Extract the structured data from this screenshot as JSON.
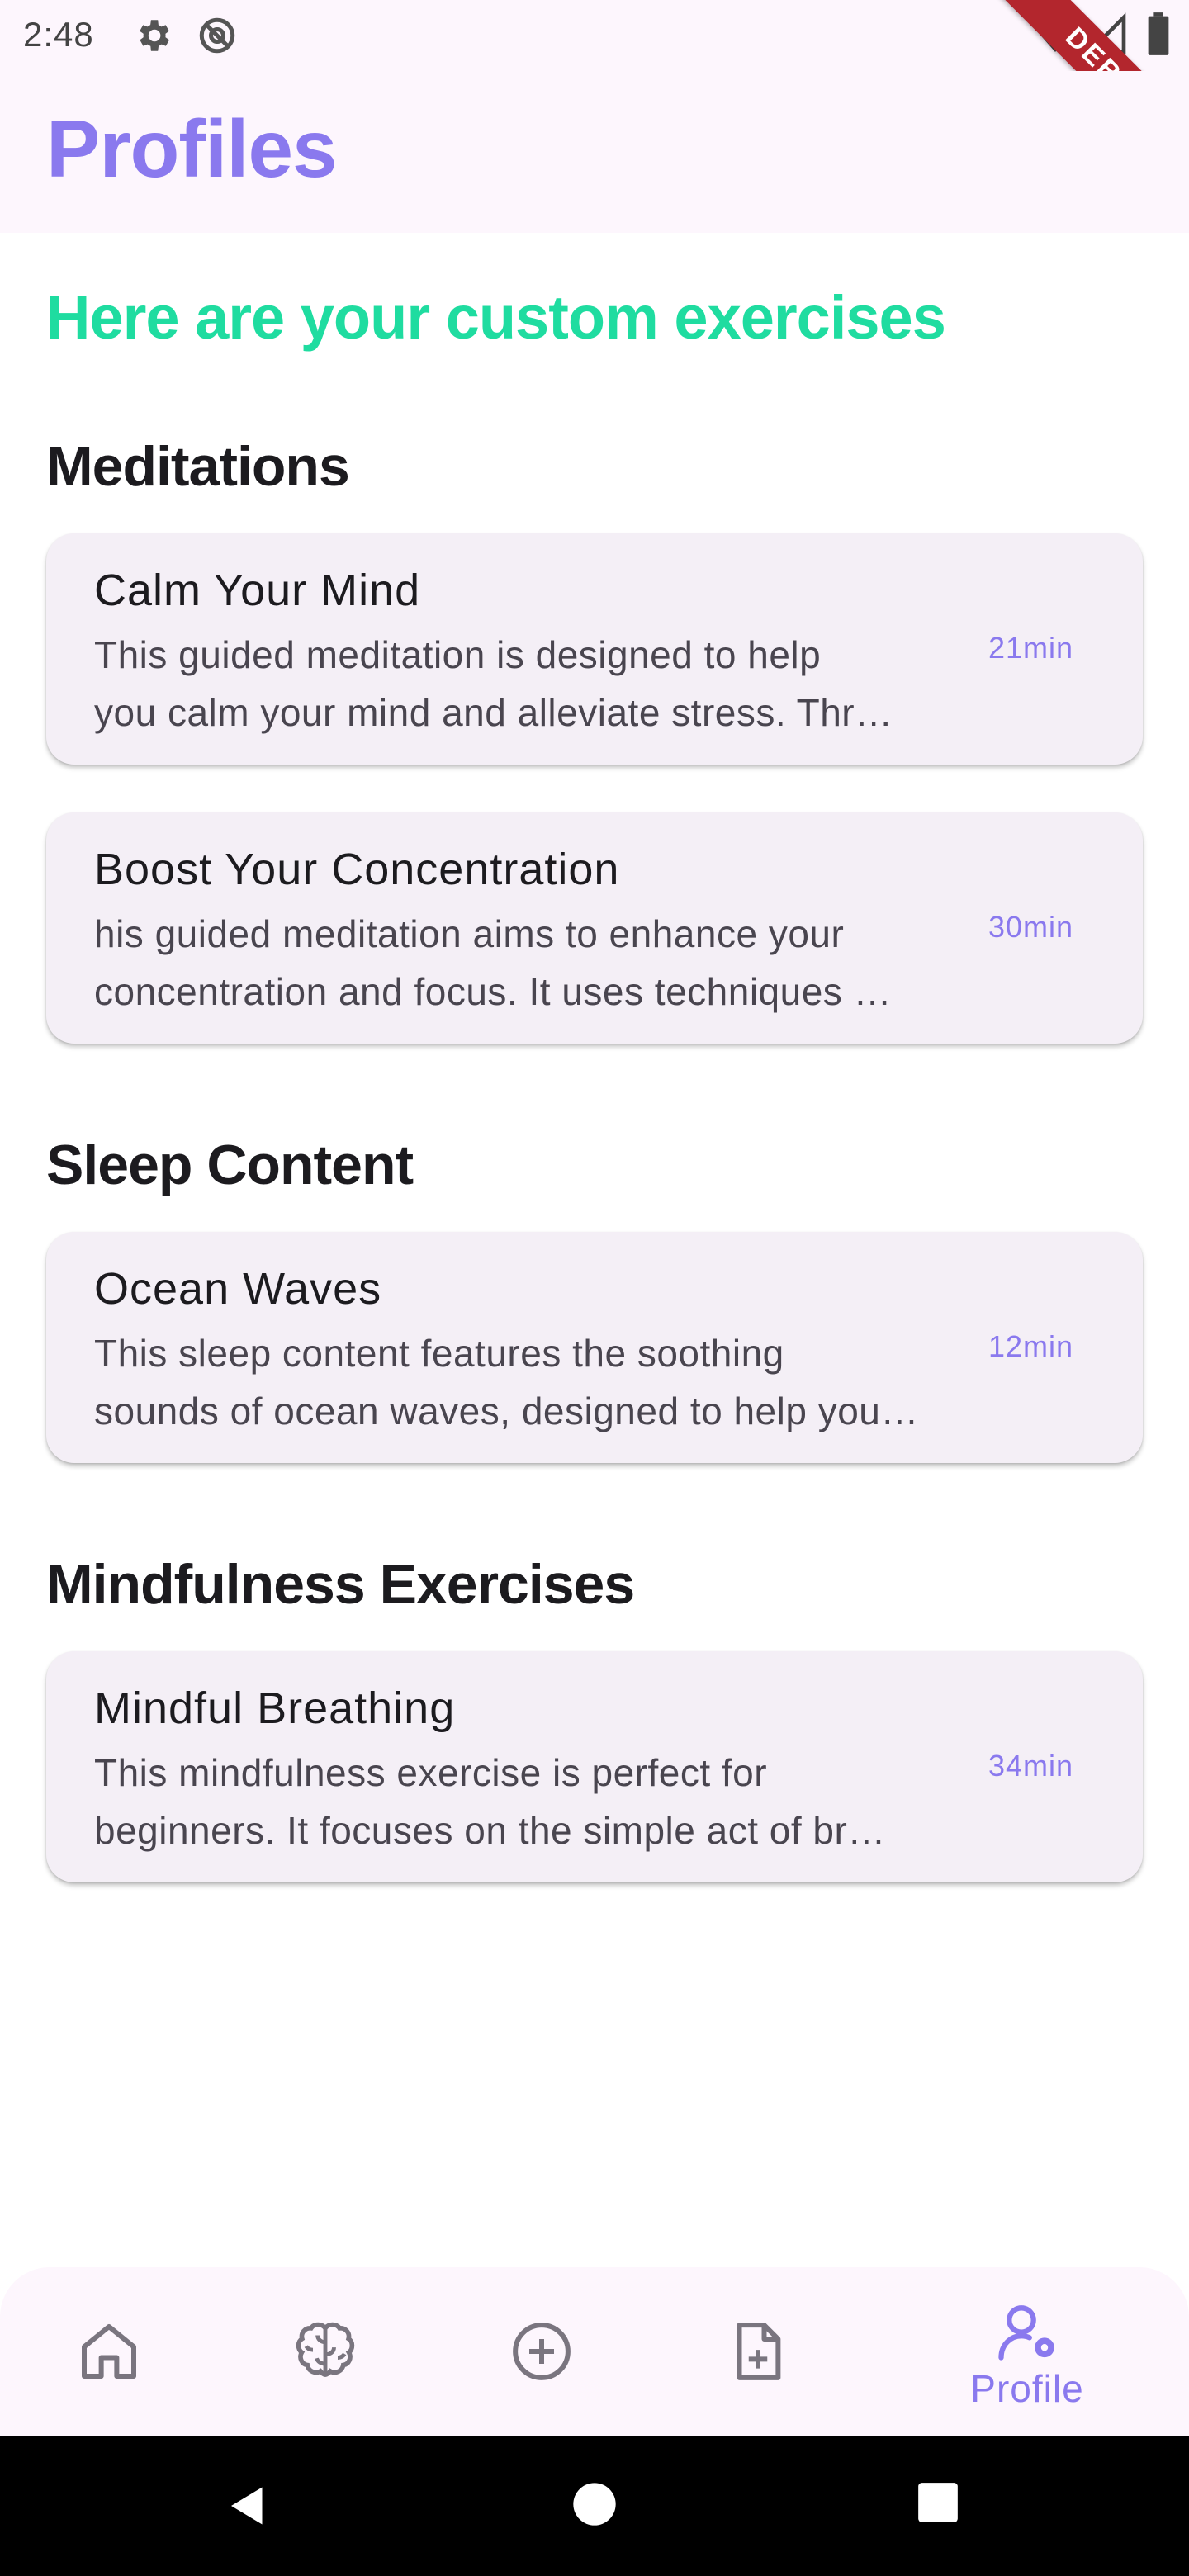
{
  "status_bar": {
    "time": "2:48",
    "icons": [
      "gear-icon",
      "at-sign-icon",
      "wifi-icon",
      "signal-icon",
      "battery-icon"
    ],
    "debug_banner": "DEBUG"
  },
  "app_bar": {
    "title": "Profiles"
  },
  "headline": "Here are your custom exercises",
  "sections": [
    {
      "title": "Meditations",
      "cards": [
        {
          "title": "Calm Your Mind",
          "desc_line1": "This guided meditation is designed to help",
          "desc_line2": "you calm your mind and alleviate stress. Thr…",
          "duration": "21min"
        },
        {
          "title": "Boost Your Concentration",
          "desc_line1": "his guided meditation aims to enhance your",
          "desc_line2": "concentration and focus. It uses techniques …",
          "duration": "30min"
        }
      ]
    },
    {
      "title": "Sleep Content",
      "cards": [
        {
          "title": "Ocean Waves",
          "desc_line1": "This sleep content features the soothing",
          "desc_line2": "sounds of ocean waves, designed to help you…",
          "duration": "12min"
        }
      ]
    },
    {
      "title": "Mindfulness Exercises",
      "cards": [
        {
          "title": "Mindful Breathing",
          "desc_line1": "This mindfulness exercise is perfect for",
          "desc_line2": "beginners. It focuses on the simple act of br…",
          "duration": "34min"
        }
      ]
    }
  ],
  "bottom_nav": {
    "items": [
      {
        "icon": "home-icon"
      },
      {
        "icon": "brain-icon"
      },
      {
        "icon": "add-circle-icon"
      },
      {
        "icon": "add-file-icon"
      },
      {
        "icon": "profile-settings-icon",
        "label": "Profile",
        "active": true
      }
    ]
  },
  "colors": {
    "accent": "#8a79ee",
    "headline": "#1fdca0",
    "card_bg": "#f4eff6",
    "app_bar_bg": "#fdf6fd",
    "debug_ribbon": "#b3262d"
  }
}
